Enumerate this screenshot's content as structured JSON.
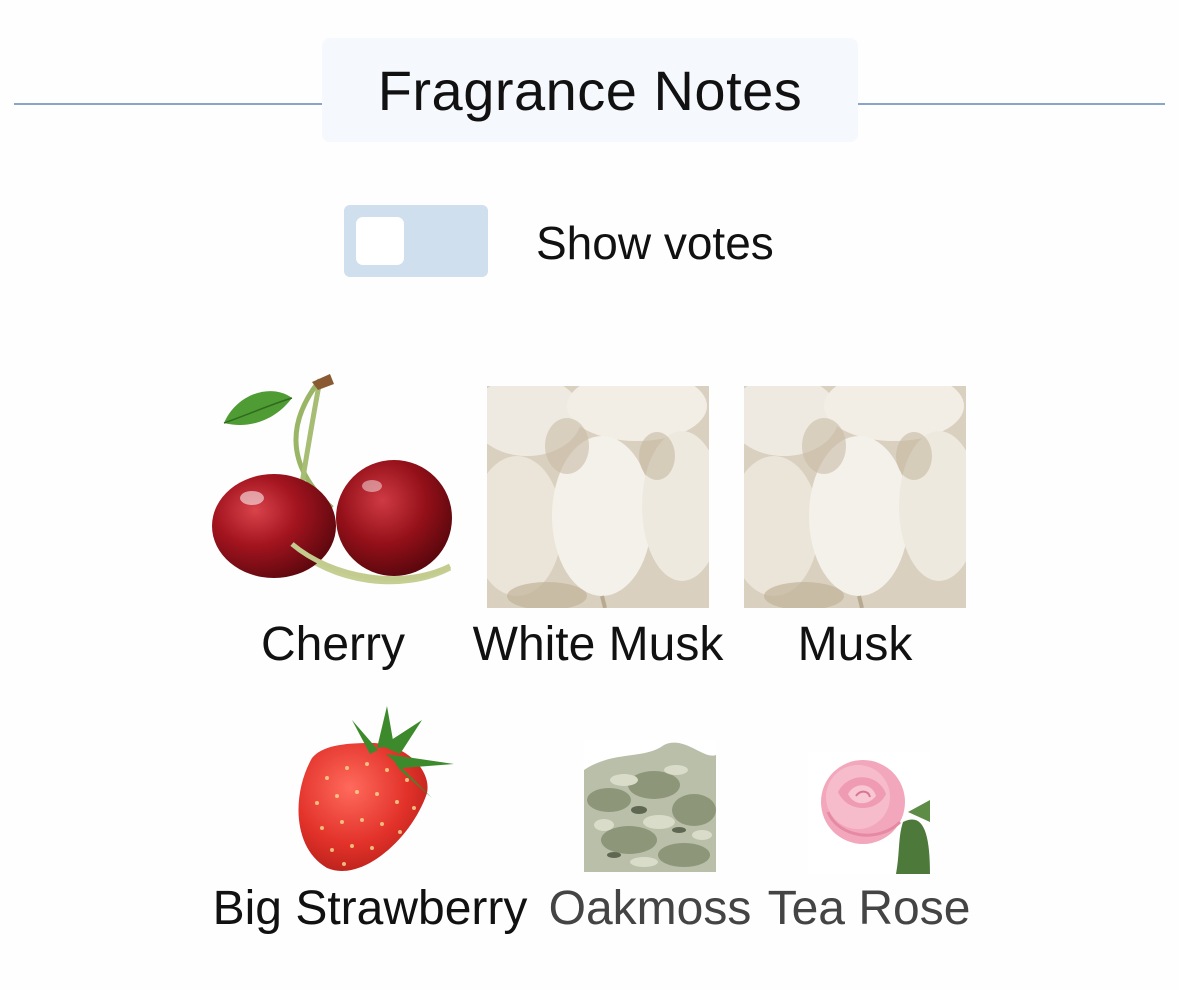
{
  "header": {
    "title": "Fragrance Notes"
  },
  "votes_toggle": {
    "label": "Show votes",
    "checked": false
  },
  "colors": {
    "rule": "#8aa6c6",
    "title_background": "#f5f8fd",
    "toggle_track": "#cfdfed",
    "muted_text": "#444444"
  },
  "notes": [
    {
      "name": "Cherry",
      "icon": "cherry-icon"
    },
    {
      "name": "White Musk",
      "icon": "white-musk-icon"
    },
    {
      "name": "Musk",
      "icon": "musk-icon"
    },
    {
      "name": "Big Strawberry",
      "icon": "strawberry-icon"
    },
    {
      "name": "Oakmoss",
      "icon": "oakmoss-icon"
    },
    {
      "name": "Tea Rose",
      "icon": "tea-rose-icon"
    }
  ]
}
